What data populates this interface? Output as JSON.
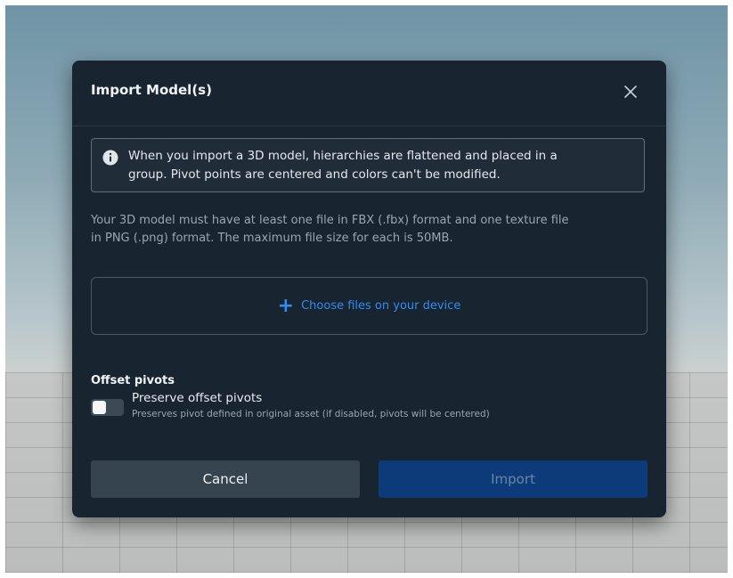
{
  "dialog": {
    "title": "Import Model(s)",
    "close_icon": "close-icon"
  },
  "info": {
    "icon": "info-icon",
    "line1": "When you import a 3D model, hierarchies are flattened and placed in a",
    "line2": "group. Pivot points are centered and colors can't be modified."
  },
  "description": {
    "line1": "Your 3D model must have at least one file in FBX (.fbx) format and one texture file",
    "line2": "in PNG (.png) format. The maximum file size for each is 50MB."
  },
  "dropzone": {
    "icon": "plus-icon",
    "label": "Choose files on your device"
  },
  "offset_pivots": {
    "section_title": "Offset pivots",
    "toggle_label": "Preserve offset pivots",
    "toggle_help": "Preserves pivot defined in original asset (if disabled, pivots will be centered)",
    "enabled": false
  },
  "buttons": {
    "cancel": "Cancel",
    "import": "Import"
  },
  "colors": {
    "dialog_bg": "#18242f",
    "accent": "#2f8cf2",
    "import_bg": "#0d3a78",
    "cancel_bg": "#36444f"
  }
}
